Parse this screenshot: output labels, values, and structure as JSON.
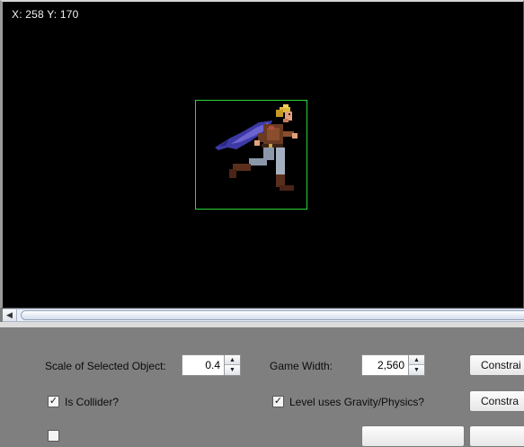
{
  "canvas": {
    "coord_x_label": "X:",
    "coord_x_value": "258",
    "coord_y_label": "Y:",
    "coord_y_value": "170",
    "background": "#000000",
    "selection_color": "#2ad43a"
  },
  "scrollbar": {
    "left_arrow": "◀"
  },
  "settings": {
    "scale_label": "Scale of Selected Object:",
    "scale_value": "0.4",
    "game_width_label": "Game Width:",
    "game_width_value": "2,560",
    "collider_label": "Is Collider?",
    "collider_checked": true,
    "gravity_label": "Level uses Gravity/Physics?",
    "gravity_checked": true,
    "constraint_button_1": "Constrai",
    "constraint_button_2": "Constra",
    "spinner_up": "▲",
    "spinner_down": "▼",
    "check_mark": "✓"
  }
}
